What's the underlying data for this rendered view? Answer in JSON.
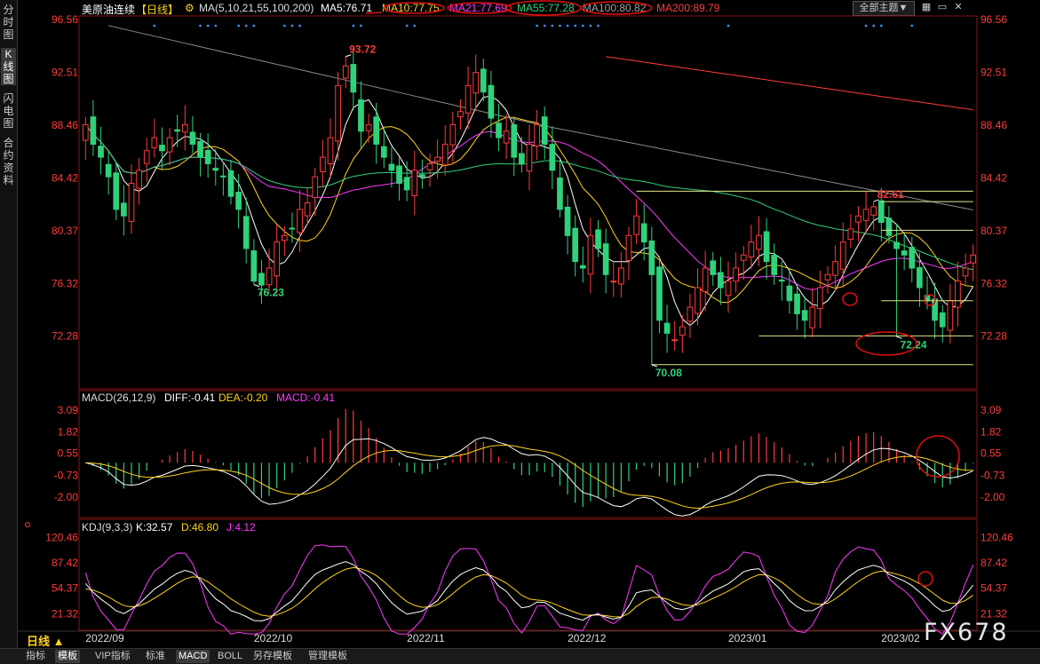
{
  "sidebar": {
    "tabs": [
      "分时图",
      "K线图",
      "闪电图",
      "合约资料"
    ],
    "active": 1
  },
  "header": {
    "title": "美原油连续",
    "period": "【日线】",
    "ma_group": "MA(5,10,21,55,100,200)",
    "ma5": "MA5:76.71",
    "ma10": "MA10:77.75",
    "ma21": "MA21:77.69",
    "ma55": "MA55:77.28",
    "ma100": "MA100:80.82",
    "ma200": "MA200:89.79",
    "theme_button": "全部主题▼"
  },
  "colors": {
    "up": "#ff3c3c",
    "down": "#2fd27a",
    "ma5": "#ffffff",
    "ma10": "#ffd21e",
    "ma21": "#ff39ff",
    "ma55": "#2fd27a",
    "ma100": "#8a8a8a",
    "ma200": "#ff3c3c",
    "axis": "#ff3c3c",
    "annotation": "#e01010"
  },
  "chart_data": [
    {
      "type": "candlestick",
      "title": "美原油连续",
      "ylim": [
        70.08,
        96.56
      ],
      "yticks": [
        96.56,
        92.51,
        88.46,
        84.42,
        80.37,
        76.32,
        72.28
      ],
      "ytick_labels": [
        "96.56",
        "92.51",
        "88.46",
        "84.42",
        "80.37",
        "76.32",
        "72.28"
      ],
      "x_labels": [
        "2022/09",
        "2022/10",
        "2022/11",
        "2022/12",
        "2023/01",
        "2023/02"
      ],
      "x_label_index": [
        0,
        22,
        42,
        63,
        84,
        104
      ],
      "x_count": 117,
      "closes": [
        88.5,
        87.0,
        86.0,
        84.5,
        82.0,
        81.5,
        84.0,
        85.0,
        86.5,
        87.5,
        86.5,
        87.5,
        88.0,
        88.5,
        87.0,
        86.0,
        85.5,
        85.0,
        84.5,
        83.0,
        82.0,
        79.0,
        76.5,
        76.2,
        77.5,
        79.5,
        80.0,
        80.5,
        82.0,
        82.5,
        84.5,
        86.0,
        87.5,
        91.5,
        93.0,
        91.0,
        88.0,
        88.5,
        87.0,
        86.0,
        85.0,
        84.0,
        83.5,
        85.0,
        84.5,
        85.5,
        86.0,
        87.0,
        88.5,
        89.5,
        91.5,
        92.5,
        91.0,
        89.0,
        87.5,
        88.0,
        86.0,
        85.5,
        87.0,
        88.5,
        87.0,
        85.0,
        82.0,
        80.0,
        78.0,
        77.5,
        80.0,
        79.0,
        77.0,
        76.5,
        77.5,
        80.0,
        81.5,
        79.5,
        77.0,
        73.5,
        72.5,
        72.0,
        73.0,
        74.5,
        76.0,
        77.5,
        77.0,
        76.0,
        76.5,
        77.5,
        78.5,
        79.5,
        80.0,
        78.0,
        77.0,
        76.5,
        75.0,
        74.0,
        73.5,
        74.5,
        76.0,
        77.0,
        78.0,
        79.5,
        80.5,
        81.5,
        82.0,
        82.2,
        81.0,
        80.0,
        79.0,
        78.5,
        77.5,
        76.0,
        75.0,
        73.5,
        73.0,
        75.0,
        76.5,
        77.5,
        78.5
      ],
      "annotations": [
        {
          "label": "93.72",
          "value": 93.72,
          "index": 34,
          "color": "red"
        },
        {
          "label": "76.23",
          "value": 76.23,
          "index": 22,
          "color": "green"
        },
        {
          "label": "70.08",
          "value": 70.08,
          "index": 74,
          "color": "green"
        },
        {
          "label": "82.61",
          "value": 82.61,
          "index": 103,
          "color": "red"
        },
        {
          "label": "72.24",
          "value": 72.24,
          "index": 106,
          "color": "green"
        }
      ],
      "levels": [
        83.4,
        82.6,
        80.4,
        75.0,
        72.3,
        70.1
      ]
    },
    {
      "type": "line+bar",
      "title": "MACD(26,12,9)",
      "diff": "DIFF:-0.41",
      "dea": "DEA:-0.20",
      "macd": "MACD:-0.41",
      "ylim": [
        -3.0,
        3.5
      ],
      "yticks": [
        3.09,
        1.82,
        0.55,
        -0.73,
        -2.0
      ],
      "ytick_labels": [
        "3.09",
        "1.82",
        "0.55",
        "-0.73",
        "-2.00"
      ]
    },
    {
      "type": "line",
      "title": "KDJ(9,3,3)",
      "k": "K:32.57",
      "d": "D:46.80",
      "j": "J:4.12",
      "ylim": [
        0,
        130
      ],
      "yticks": [
        120.46,
        87.42,
        54.37,
        21.32
      ],
      "ytick_labels": [
        "120.46",
        "87.42",
        "54.37",
        "21.32"
      ]
    }
  ],
  "bottom_tabs": [
    "指标",
    "模板",
    "VIP指标",
    "标准",
    "MACD",
    "BOLL",
    "另存模板",
    "管理模板"
  ],
  "bottom_active": [
    1,
    4
  ],
  "period_button": "日线 ▲",
  "watermark": "FX678"
}
